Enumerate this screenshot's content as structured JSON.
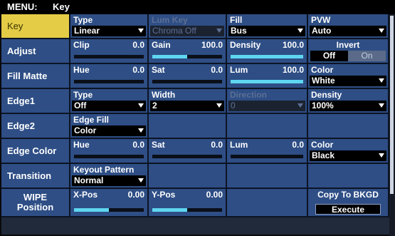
{
  "title": {
    "menu": "MENU:",
    "name": "Key"
  },
  "rows": {
    "key": {
      "label": "Key",
      "type": {
        "title": "Type",
        "value": "Linear"
      },
      "lum_key": {
        "title": "Lum Key",
        "value": "Chroma Off"
      },
      "fill": {
        "title": "Fill",
        "value": "Bus"
      },
      "pvw": {
        "title": "PVW",
        "value": "Auto"
      }
    },
    "adjust": {
      "label": "Adjust",
      "clip": {
        "title": "Clip",
        "value": "0.0",
        "level": 0.0
      },
      "gain": {
        "title": "Gain",
        "value": "100.0",
        "level": 0.5
      },
      "density": {
        "title": "Density",
        "value": "100.0",
        "level": 1.0
      },
      "invert": {
        "title": "Invert",
        "off": "Off",
        "on": "On",
        "selected": "Off"
      }
    },
    "fill_matte": {
      "label": "Fill Matte",
      "hue": {
        "title": "Hue",
        "value": "0.0",
        "level": 0.0
      },
      "sat": {
        "title": "Sat",
        "value": "0.0",
        "level": 0.0
      },
      "lum": {
        "title": "Lum",
        "value": "100.0",
        "level": 1.0
      },
      "color": {
        "title": "Color",
        "value": "White"
      }
    },
    "edge1": {
      "label": "Edge1",
      "type": {
        "title": "Type",
        "value": "Off"
      },
      "width": {
        "title": "Width",
        "value": "2"
      },
      "direction": {
        "title": "Direction",
        "value": "0"
      },
      "density": {
        "title": "Density",
        "value": "100%"
      }
    },
    "edge2": {
      "label": "Edge2",
      "edge_fill": {
        "title": "Edge Fill",
        "value": "Color"
      }
    },
    "edge_color": {
      "label": "Edge Color",
      "hue": {
        "title": "Hue",
        "value": "0.0",
        "level": 0.0
      },
      "sat": {
        "title": "Sat",
        "value": "0.0",
        "level": 0.0
      },
      "lum": {
        "title": "Lum",
        "value": "0.0",
        "level": 0.0
      },
      "color": {
        "title": "Color",
        "value": "Black"
      }
    },
    "transition": {
      "label": "Transition",
      "keyout_pattern": {
        "title": "Keyout Pattern",
        "value": "Normal"
      }
    },
    "wipe_position": {
      "label_line1": "WIPE",
      "label_line2": "Position",
      "x_pos": {
        "title": "X-Pos",
        "value": "0.00",
        "level": 0.5
      },
      "y_pos": {
        "title": "Y-Pos",
        "value": "0.00",
        "level": 0.5
      },
      "copy_to_bkgd": {
        "title": "Copy To BKGD",
        "button": "Execute"
      }
    }
  },
  "colors": {
    "panel": "#2e4e85",
    "selected_label": "#e4cc46",
    "slider_fill": "#5fd6f0"
  }
}
